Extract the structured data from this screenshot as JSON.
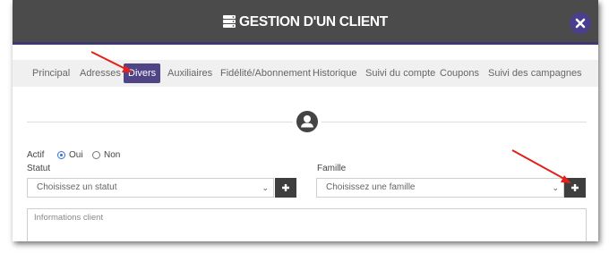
{
  "dialog": {
    "title": "GESTION D'UN CLIENT",
    "title_icon": "server-icon",
    "close_icon": "close-icon"
  },
  "tabs": [
    {
      "label": "Principal"
    },
    {
      "label": "Adresses"
    },
    {
      "label": "Divers"
    },
    {
      "label": "Auxiliaires"
    },
    {
      "label": "Fidélité/Abonnement"
    },
    {
      "label": "Historique"
    },
    {
      "label": "Suivi du compte"
    },
    {
      "label": "Coupons"
    },
    {
      "label": "Suivi des campagnes"
    }
  ],
  "active_tab": "Divers",
  "form": {
    "actif_label": "Actif",
    "oui_label": "Oui",
    "non_label": "Non",
    "actif_value": "Oui",
    "statut_label": "Statut",
    "statut_placeholder": "Choisissez un statut",
    "famille_label": "Famille",
    "famille_placeholder": "Choisissez une famille",
    "informations_placeholder": "Informations client"
  },
  "colors": {
    "header_bg": "#4b4b4b",
    "accent": "#4f4486",
    "annotation_arrow": "#e3201b"
  }
}
